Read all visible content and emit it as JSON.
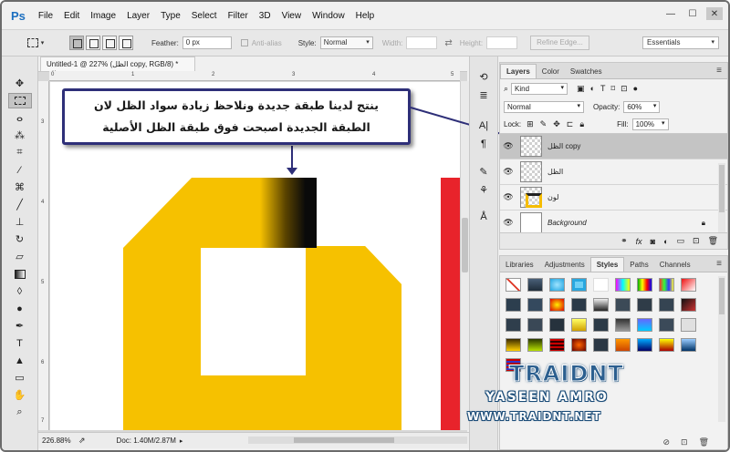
{
  "app": {
    "logo": "Ps"
  },
  "menu": [
    "File",
    "Edit",
    "Image",
    "Layer",
    "Type",
    "Select",
    "Filter",
    "3D",
    "View",
    "Window",
    "Help"
  ],
  "window_controls": {
    "minimize": "—",
    "maximize": "☐",
    "close": "✕"
  },
  "options_bar": {
    "feather_label": "Feather:",
    "feather_value": "0 px",
    "antialias_label": "Anti-alias",
    "style_label": "Style:",
    "style_value": "Normal",
    "width_label": "Width:",
    "height_label": "Height:",
    "refine_edge": "Refine Edge...",
    "workspace": "Essentials"
  },
  "document": {
    "tab_title": "Untitled-1 @ 227% (الظل copy, RGB/8) *",
    "close_glyph": "×",
    "ruler_top": [
      "0",
      "1",
      "2",
      "3",
      "4",
      "5"
    ],
    "ruler_left": [
      "3",
      "4",
      "5",
      "6",
      "7"
    ]
  },
  "status": {
    "zoom": "226.88%",
    "doc": "Doc: 1.40M/2.87M"
  },
  "annotation": {
    "line1": "ينتج لدينا طبقة جديدة ونلاحظ زيادة سواد الظل لان",
    "line2": "الطبقة الجديدة اصبحت فوق طبقة الظل الأصلية"
  },
  "layers_panel": {
    "tabs": [
      "Layers",
      "Color",
      "Swatches"
    ],
    "active_tab": "Layers",
    "kind": "Kind",
    "blend_mode": "Normal",
    "opacity_label": "Opacity:",
    "opacity_value": "60%",
    "lock_label": "Lock:",
    "fill_label": "Fill:",
    "fill_value": "100%",
    "layers": [
      {
        "name": "الظل copy",
        "selected": true
      },
      {
        "name": "الظل",
        "selected": false
      },
      {
        "name": "لون",
        "selected": false
      },
      {
        "name": "Background",
        "selected": false,
        "locked": true
      }
    ],
    "bottom_icons": [
      "link-icon",
      "fx-icon",
      "mask-icon",
      "adjustment-icon",
      "group-icon",
      "new-layer-icon",
      "trash-icon"
    ]
  },
  "styles_panel": {
    "tabs": [
      "Libraries",
      "Adjustments",
      "Styles",
      "Paths",
      "Channels"
    ],
    "active_tab": "Styles"
  },
  "watermark": {
    "brand": "TRAIDNT",
    "name": "YASEEN AMRO",
    "url": "WWW.TRAIDNT.NET"
  },
  "colors": {
    "shape_yellow": "#F6C100",
    "shadow_black": "#0A0A0A",
    "edge_red": "#E8232B",
    "callout_border": "#2E2F78",
    "arrow_color": "#2E2F78"
  }
}
